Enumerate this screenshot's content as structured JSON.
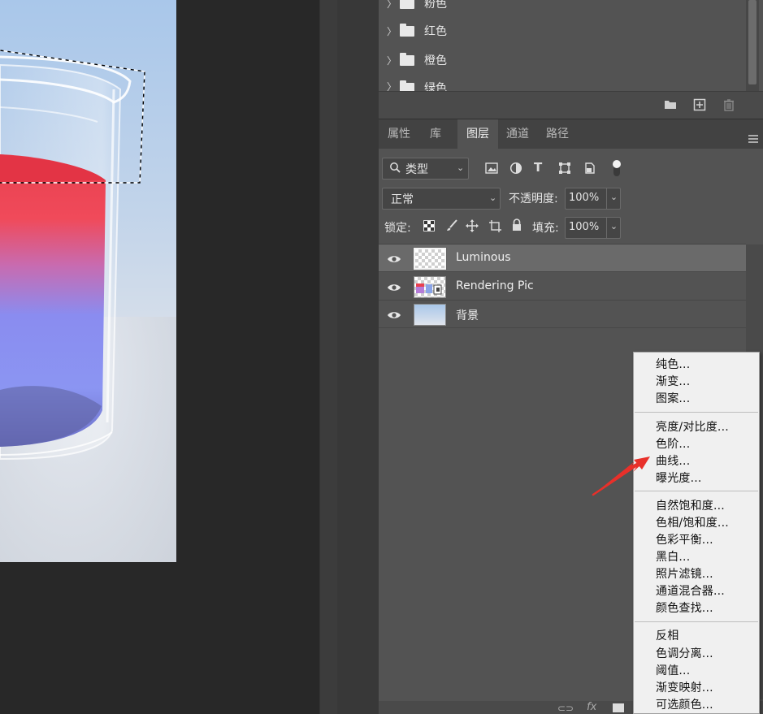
{
  "swatches_panel": {
    "folders": [
      "粉色",
      "红色",
      "橙色",
      "绿色"
    ]
  },
  "panel_tabs": [
    "属性",
    "库",
    "图层",
    "通道",
    "路径"
  ],
  "active_tab": "图层",
  "layers_toolbar": {
    "filter_label": "类型",
    "blend_mode": "正常",
    "opacity_label": "不透明度:",
    "opacity_value": "100%",
    "lock_label": "锁定:",
    "fill_label": "填充:",
    "fill_value": "100%"
  },
  "layers": [
    {
      "name": "Luminous",
      "selected": true
    },
    {
      "name": "Rendering Pic",
      "selected": false
    },
    {
      "name": "背景",
      "selected": false
    }
  ],
  "context_menu": {
    "groups": [
      [
        "纯色...",
        "渐变...",
        "图案..."
      ],
      [
        "亮度/对比度...",
        "色阶...",
        "曲线...",
        "曝光度..."
      ],
      [
        "自然饱和度...",
        "色相/饱和度...",
        "色彩平衡...",
        "黑白...",
        "照片滤镜...",
        "通道混合器...",
        "颜色查找..."
      ],
      [
        "反相",
        "色调分离...",
        "阈值...",
        "渐变映射...",
        "可选颜色..."
      ]
    ],
    "highlighted_item": "曲线..."
  },
  "annotation_arrow_color": "#e8302a",
  "footer_icons": [
    "link-icon",
    "fx-icon",
    "mask-icon"
  ]
}
